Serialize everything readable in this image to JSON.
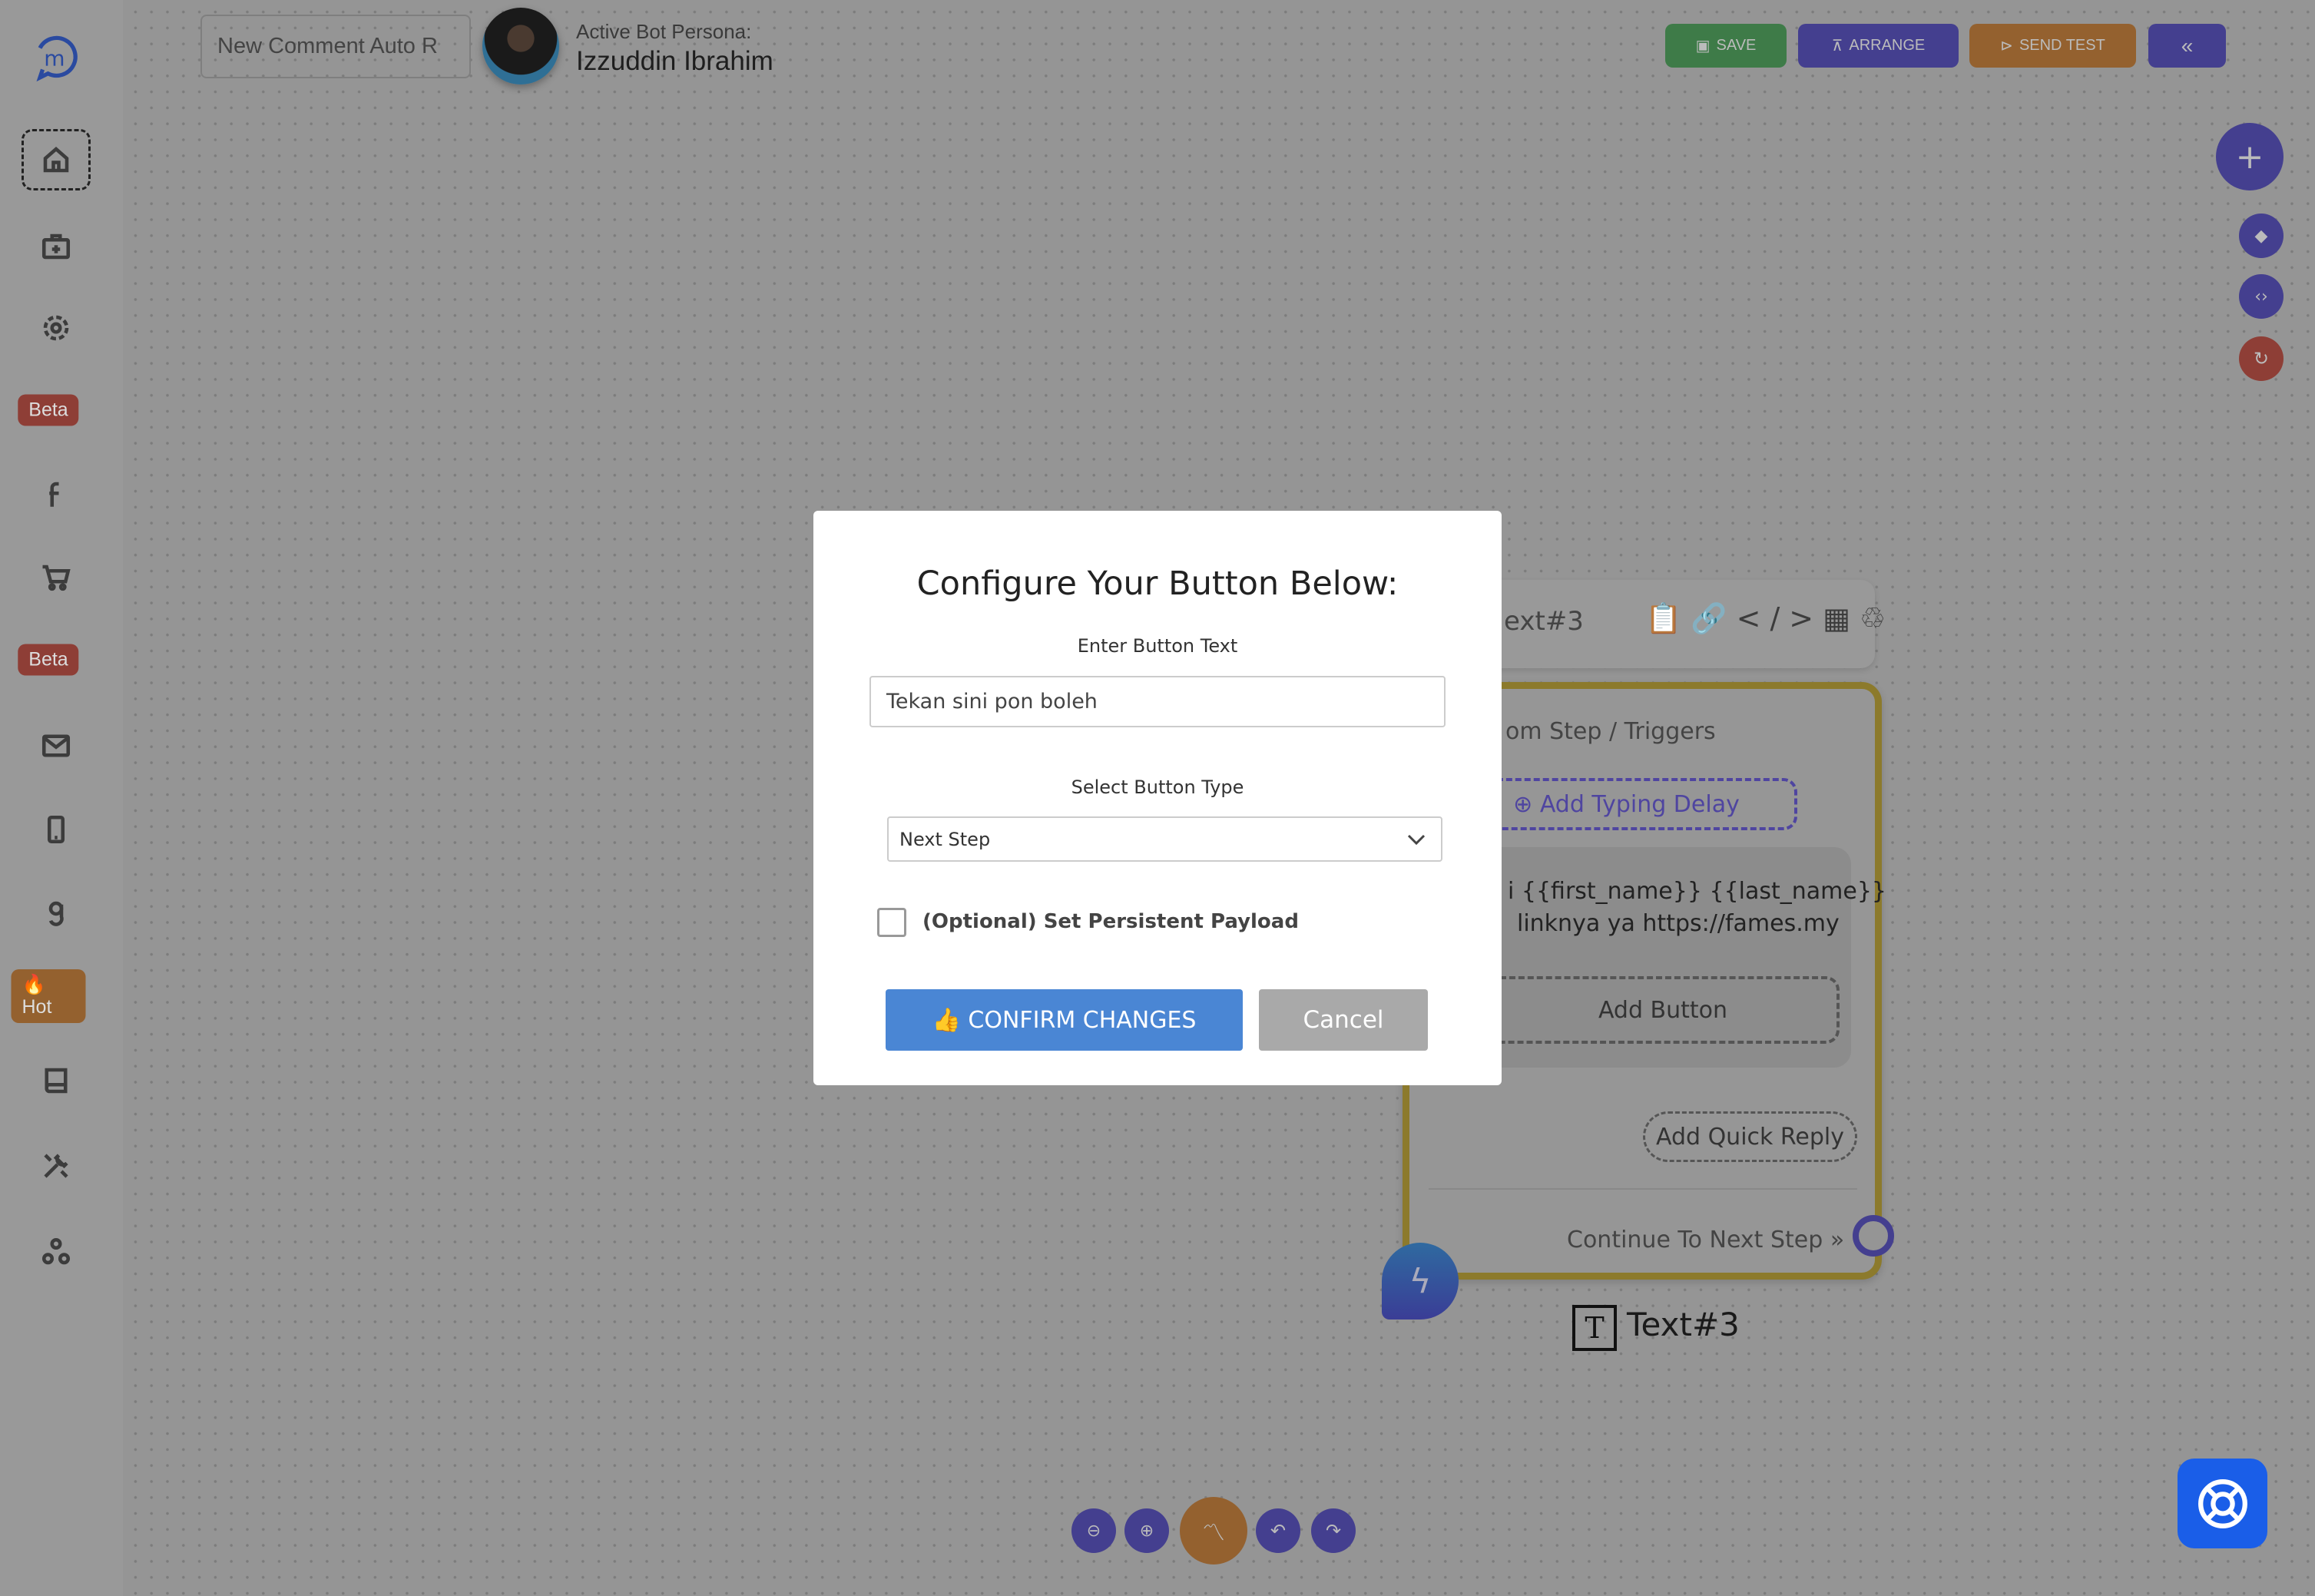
{
  "header": {
    "flow_name": "New Comment Auto R",
    "persona_label": "Active Bot Persona:",
    "persona_name": "Izzuddin Ibrahim",
    "buttons": {
      "save": "SAVE",
      "arrange": "ARRANGE",
      "send_test": "SEND TEST",
      "collapse": "«"
    }
  },
  "sidebar": {
    "badges": {
      "beta1": "Beta",
      "beta2": "Beta",
      "hot": "🔥Hot"
    }
  },
  "colors": {
    "save": "#3e7b48",
    "primary": "#443f8f",
    "send_test": "#94612f",
    "danger": "#8e3e36",
    "confirm": "#4a86d4",
    "cancel": "#a9a9a9",
    "node_border": "#8c7a2c"
  },
  "node": {
    "header_title": "ext#3",
    "trigger_text": "om Step / Triggers",
    "typing_delay": "⊕ Add Typing Delay",
    "message_line1": "i {{first_name}} {{last_name}}",
    "message_line2": "linknya ya https://fames.my",
    "add_button": "Add Button",
    "add_quick_reply": "Add Quick Reply",
    "continue": "Continue To Next Step",
    "label": "Text#3"
  },
  "modal": {
    "title": "Configure Your Button Below:",
    "text_label": "Enter Button Text",
    "text_value": "Tekan sini pon boleh",
    "type_label": "Select Button Type",
    "type_value": "Next Step",
    "payload_label": "(Optional) Set Persistent Payload",
    "payload_checked": false,
    "confirm": "👍 CONFIRM CHANGES",
    "cancel": "Cancel"
  }
}
